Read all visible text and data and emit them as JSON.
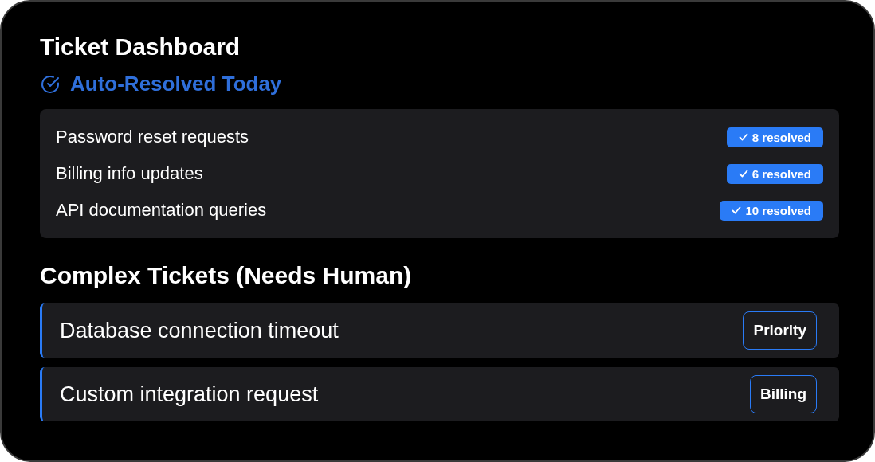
{
  "title": "Ticket Dashboard",
  "auto_resolved": {
    "heading": "Auto-Resolved Today",
    "items": [
      {
        "label": "Password reset requests",
        "badge": "8 resolved"
      },
      {
        "label": "Billing info updates",
        "badge": "6 resolved"
      },
      {
        "label": "API documentation queries",
        "badge": "10 resolved"
      }
    ]
  },
  "complex": {
    "heading": "Complex Tickets (Needs Human)",
    "tickets": [
      {
        "label": "Database connection timeout",
        "tag": "Priority"
      },
      {
        "label": "Custom integration request",
        "tag": "Billing"
      }
    ]
  }
}
